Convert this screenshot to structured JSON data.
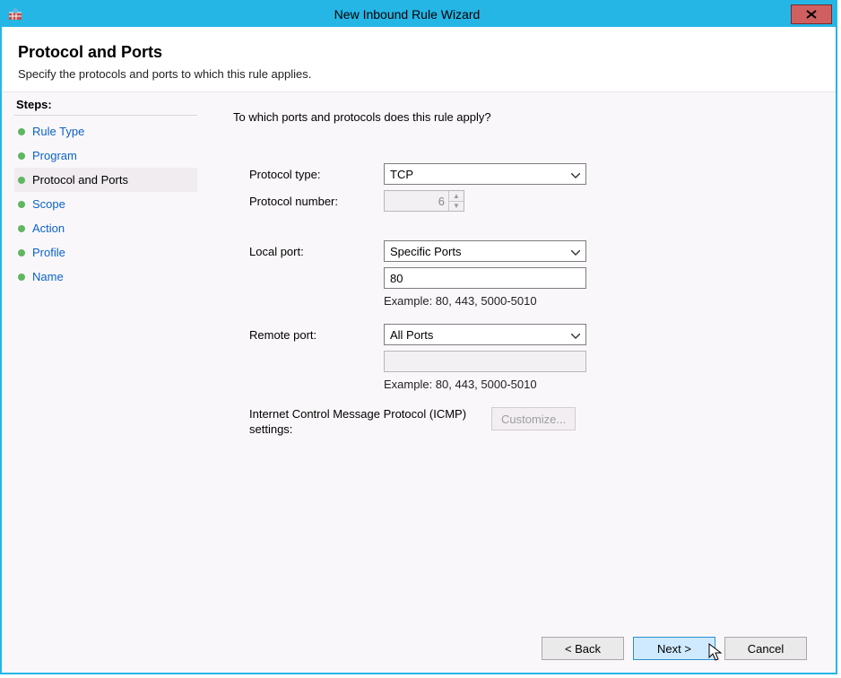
{
  "window": {
    "title": "New Inbound Rule Wizard"
  },
  "header": {
    "heading": "Protocol and Ports",
    "subtitle": "Specify the protocols and ports to which this rule applies."
  },
  "sidebar": {
    "steps_label": "Steps:",
    "items": [
      {
        "label": "Rule Type",
        "current": false
      },
      {
        "label": "Program",
        "current": false
      },
      {
        "label": "Protocol and Ports",
        "current": true
      },
      {
        "label": "Scope",
        "current": false
      },
      {
        "label": "Action",
        "current": false
      },
      {
        "label": "Profile",
        "current": false
      },
      {
        "label": "Name",
        "current": false
      }
    ]
  },
  "main": {
    "question": "To which ports and protocols does this rule apply?",
    "protocol_type_label": "Protocol type:",
    "protocol_type_value": "TCP",
    "protocol_number_label": "Protocol number:",
    "protocol_number_value": "6",
    "local_port_label": "Local port:",
    "local_port_select": "Specific Ports",
    "local_port_value": "80",
    "local_port_example": "Example: 80, 443, 5000-5010",
    "remote_port_label": "Remote port:",
    "remote_port_select": "All Ports",
    "remote_port_value": "",
    "remote_port_example": "Example: 80, 443, 5000-5010",
    "icmp_label": "Internet Control Message Protocol (ICMP) settings:",
    "customize_label": "Customize..."
  },
  "footer": {
    "back": "< Back",
    "next": "Next >",
    "cancel": "Cancel"
  }
}
